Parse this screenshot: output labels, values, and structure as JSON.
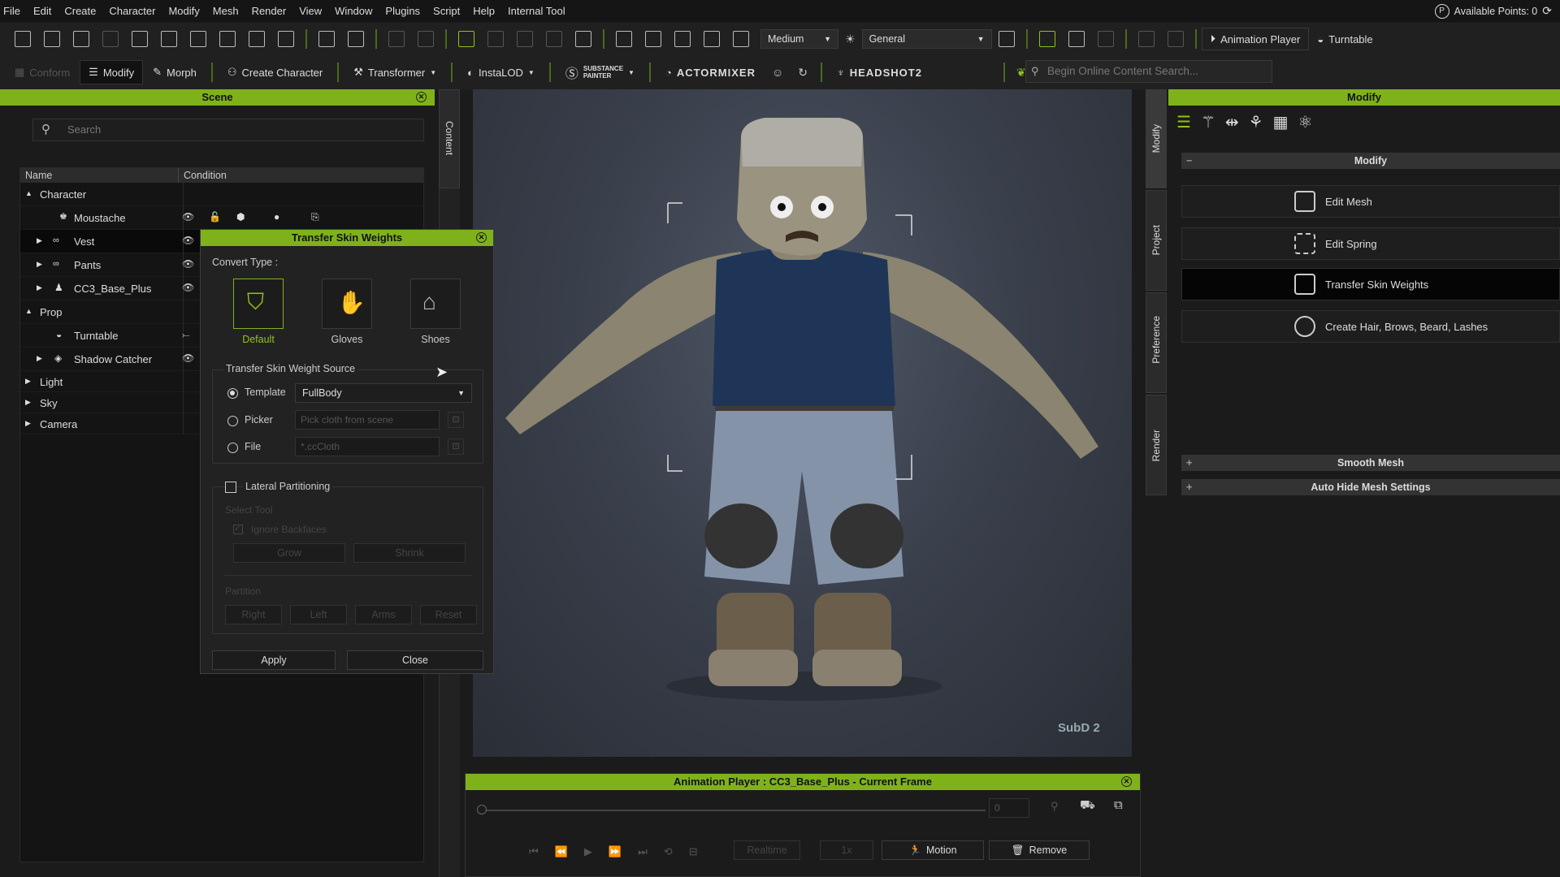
{
  "menubar": {
    "items": [
      "File",
      "Edit",
      "Create",
      "Character",
      "Modify",
      "Mesh",
      "Render",
      "View",
      "Window",
      "Plugins",
      "Script",
      "Help",
      "Internal Tool"
    ],
    "available_points": "Available Points: 0"
  },
  "toolbar1": {
    "quality": "Medium",
    "preset": "General",
    "animation_player": "Animation Player",
    "turntable": "Turntable"
  },
  "toolbar2": {
    "conform": "Conform",
    "modify": "Modify",
    "morph": "Morph",
    "create_character": "Create Character",
    "transformer": "Transformer",
    "instalod": "InstaLOD",
    "substance_line1": "SUBSTANCE",
    "substance_line2": "PAINTER",
    "actormixer": "ACTORMIXER",
    "headshot": "HEADSHOT2",
    "search_placeholder": "Begin Online Content Search..."
  },
  "scene": {
    "title": "Scene",
    "search_placeholder": "Search",
    "col_name": "Name",
    "col_condition": "Condition",
    "content_tab": "Content",
    "rows": [
      {
        "label": "Character"
      },
      {
        "label": "Moustache"
      },
      {
        "label": "Vest"
      },
      {
        "label": "Pants"
      },
      {
        "label": "CC3_Base_Plus"
      },
      {
        "label": "Prop"
      },
      {
        "label": "Turntable"
      },
      {
        "label": "Shadow Catcher"
      },
      {
        "label": "Light"
      },
      {
        "label": "Sky"
      },
      {
        "label": "Camera"
      }
    ]
  },
  "dialog": {
    "title": "Transfer Skin Weights",
    "convert_type_label": "Convert Type :",
    "types": [
      "Default",
      "Gloves",
      "Shoes"
    ],
    "selected_type": "Default",
    "source_label": "Transfer Skin Weight Source",
    "template_label": "Template",
    "template_value": "FullBody",
    "picker_label": "Picker",
    "picker_placeholder": "Pick cloth from scene",
    "file_label": "File",
    "file_placeholder": "*.ccCloth",
    "lateral_label": "Lateral Partitioning",
    "select_tool": "Select Tool",
    "ignore_backfaces": "Ignore Backfaces",
    "grow": "Grow",
    "shrink": "Shrink",
    "partition": "Partition",
    "right": "Right",
    "left": "Left",
    "arms": "Arms",
    "reset": "Reset",
    "apply": "Apply",
    "close": "Close"
  },
  "viewport": {
    "subd": "SubD 2"
  },
  "anim_player": {
    "title": "Animation Player : CC3_Base_Plus - Current Frame",
    "frame": "0",
    "realtime": "Realtime",
    "speed": "1x",
    "motion": "Motion",
    "remove": "Remove"
  },
  "right_tabs": [
    "Modify",
    "Project",
    "Preference",
    "Render"
  ],
  "modify": {
    "title": "Modify",
    "section": "Modify",
    "buttons": [
      "Edit Mesh",
      "Edit Spring",
      "Transfer Skin Weights",
      "Create Hair, Brows, Beard, Lashes"
    ],
    "active_button": "Transfer Skin Weights",
    "smooth_mesh": "Smooth Mesh",
    "auto_hide": "Auto Hide Mesh Settings"
  },
  "colors": {
    "accent": "#7fb21a",
    "panel_bg": "#1b1b1b"
  }
}
